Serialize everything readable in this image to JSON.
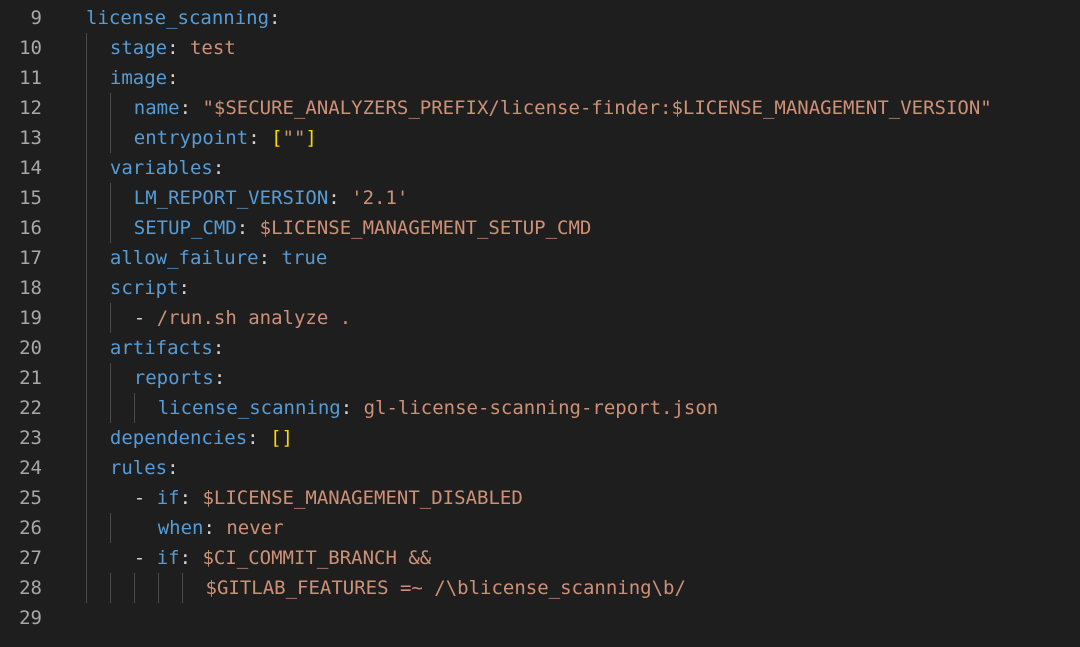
{
  "editor": {
    "language": "yaml",
    "colors": {
      "background": "#1e1e1e",
      "key": "#569cd6",
      "value": "#ce9178",
      "bracket": "#ffd700",
      "line_number": "#a8a8a8"
    },
    "lines": [
      {
        "num": "9",
        "indent": 0,
        "guides": 0,
        "tokens": [
          [
            "k",
            "license_scanning"
          ],
          [
            "p",
            ":"
          ]
        ]
      },
      {
        "num": "10",
        "indent": 1,
        "guides": 1,
        "tokens": [
          [
            "k",
            "stage"
          ],
          [
            "p",
            ": "
          ],
          [
            "s",
            "test"
          ]
        ]
      },
      {
        "num": "11",
        "indent": 1,
        "guides": 1,
        "tokens": [
          [
            "k",
            "image"
          ],
          [
            "p",
            ":"
          ]
        ]
      },
      {
        "num": "12",
        "indent": 2,
        "guides": 2,
        "tokens": [
          [
            "k",
            "name"
          ],
          [
            "p",
            ": "
          ],
          [
            "s",
            "\"$SECURE_ANALYZERS_PREFIX/license-finder:$LICENSE_MANAGEMENT_VERSION\""
          ]
        ]
      },
      {
        "num": "13",
        "indent": 2,
        "guides": 2,
        "tokens": [
          [
            "k",
            "entrypoint"
          ],
          [
            "p",
            ": "
          ],
          [
            "b",
            "["
          ],
          [
            "s",
            "\"\""
          ],
          [
            "b",
            "]"
          ]
        ]
      },
      {
        "num": "14",
        "indent": 1,
        "guides": 1,
        "tokens": [
          [
            "k",
            "variables"
          ],
          [
            "p",
            ":"
          ]
        ]
      },
      {
        "num": "15",
        "indent": 2,
        "guides": 2,
        "tokens": [
          [
            "k",
            "LM_REPORT_VERSION"
          ],
          [
            "p",
            ": "
          ],
          [
            "s",
            "'2.1'"
          ]
        ]
      },
      {
        "num": "16",
        "indent": 2,
        "guides": 2,
        "tokens": [
          [
            "k",
            "SETUP_CMD"
          ],
          [
            "p",
            ": "
          ],
          [
            "s",
            "$LICENSE_MANAGEMENT_SETUP_CMD"
          ]
        ]
      },
      {
        "num": "17",
        "indent": 1,
        "guides": 1,
        "tokens": [
          [
            "k",
            "allow_failure"
          ],
          [
            "p",
            ": "
          ],
          [
            "k",
            "true"
          ]
        ]
      },
      {
        "num": "18",
        "indent": 1,
        "guides": 1,
        "tokens": [
          [
            "k",
            "script"
          ],
          [
            "p",
            ":"
          ]
        ]
      },
      {
        "num": "19",
        "indent": 2,
        "guides": 2,
        "tokens": [
          [
            "p",
            "- "
          ],
          [
            "s",
            "/run.sh analyze ."
          ]
        ]
      },
      {
        "num": "20",
        "indent": 1,
        "guides": 1,
        "tokens": [
          [
            "k",
            "artifacts"
          ],
          [
            "p",
            ":"
          ]
        ]
      },
      {
        "num": "21",
        "indent": 2,
        "guides": 2,
        "tokens": [
          [
            "k",
            "reports"
          ],
          [
            "p",
            ":"
          ]
        ]
      },
      {
        "num": "22",
        "indent": 3,
        "guides": 3,
        "tokens": [
          [
            "k",
            "license_scanning"
          ],
          [
            "p",
            ": "
          ],
          [
            "s",
            "gl-license-scanning-report.json"
          ]
        ]
      },
      {
        "num": "23",
        "indent": 1,
        "guides": 1,
        "tokens": [
          [
            "k",
            "dependencies"
          ],
          [
            "p",
            ": "
          ],
          [
            "b",
            "[]"
          ]
        ]
      },
      {
        "num": "24",
        "indent": 1,
        "guides": 1,
        "tokens": [
          [
            "k",
            "rules"
          ],
          [
            "p",
            ":"
          ]
        ]
      },
      {
        "num": "25",
        "indent": 2,
        "guides": 1,
        "tokens": [
          [
            "p",
            "- "
          ],
          [
            "k",
            "if"
          ],
          [
            "p",
            ": "
          ],
          [
            "s",
            "$LICENSE_MANAGEMENT_DISABLED"
          ]
        ]
      },
      {
        "num": "26",
        "indent": 3,
        "guides": 2,
        "tokens": [
          [
            "k",
            "when"
          ],
          [
            "p",
            ": "
          ],
          [
            "s",
            "never"
          ]
        ]
      },
      {
        "num": "27",
        "indent": 2,
        "guides": 1,
        "tokens": [
          [
            "p",
            "- "
          ],
          [
            "k",
            "if"
          ],
          [
            "p",
            ": "
          ],
          [
            "s",
            "$CI_COMMIT_BRANCH &&"
          ]
        ]
      },
      {
        "num": "28",
        "indent": 5,
        "guides": 5,
        "tokens": [
          [
            "s",
            "$GITLAB_FEATURES =~ /\\blicense_scanning\\b/"
          ]
        ]
      },
      {
        "num": "29",
        "indent": 0,
        "guides": 0,
        "tokens": []
      }
    ]
  }
}
